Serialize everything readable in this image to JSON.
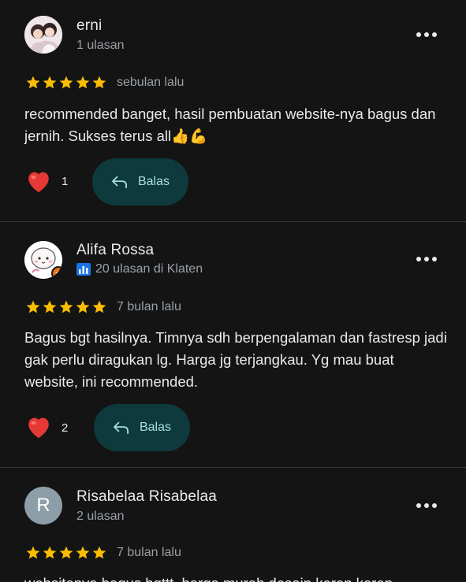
{
  "reviews": [
    {
      "name": "erni",
      "meta": "1 ulasan",
      "date": "sebulan lalu",
      "text": "recommended banget, hasil pembuatan website-nya bagus dan jernih. Sukses terus all👍💪",
      "likes": "1",
      "rating": 5,
      "reply_label": "Balas"
    },
    {
      "name": "Alifa Rossa",
      "meta": "20 ulasan di Klaten",
      "date": "7 bulan lalu",
      "text": "Bagus bgt hasilnya. Timnya sdh berpengalaman dan fastresp jadi gak perlu diragukan lg. Harga jg terjangkau. Yg mau buat website, ini recommended.",
      "likes": "2",
      "rating": 5,
      "reply_label": "Balas"
    },
    {
      "name": "Risabelaa Risabelaa",
      "meta": "2 ulasan",
      "avatar_letter": "R",
      "date": "7 bulan lalu",
      "text": "websitenya bagus bgttt, harga murah desain keren keren",
      "rating": 5
    }
  ],
  "colors": {
    "background": "#141414",
    "star": "#fbbc04",
    "reply_bg": "#0e3a3d",
    "reply_text": "#a8dfe0",
    "heart": "#e53935",
    "badge": "#e8710a"
  }
}
